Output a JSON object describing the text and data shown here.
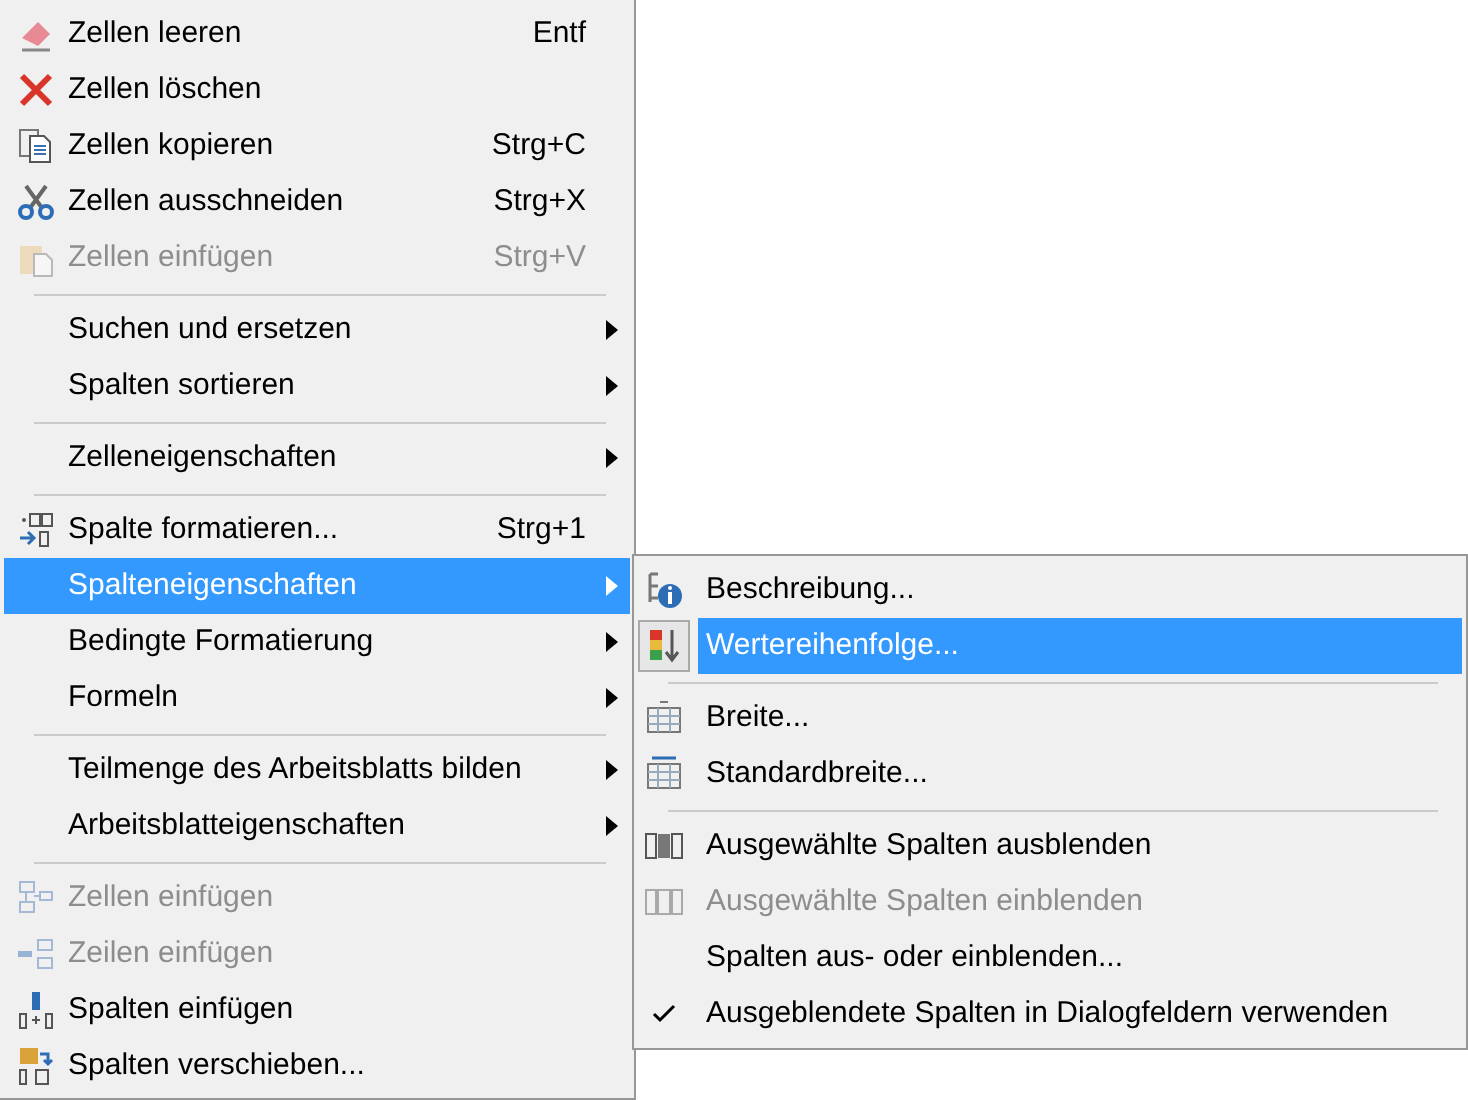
{
  "menu": {
    "items": [
      {
        "kind": "item",
        "label": "Zellen leeren",
        "shortcut": "Entf",
        "submenu": false,
        "disabled": false,
        "selected": false
      },
      {
        "kind": "item",
        "label": "Zellen löschen",
        "submenu": false,
        "disabled": false,
        "selected": false
      },
      {
        "kind": "item",
        "label": "Zellen kopieren",
        "shortcut": "Strg+C",
        "submenu": false,
        "disabled": false,
        "selected": false
      },
      {
        "kind": "item",
        "label": "Zellen ausschneiden",
        "shortcut": "Strg+X",
        "submenu": false,
        "disabled": false,
        "selected": false
      },
      {
        "kind": "item",
        "label": "Zellen einfügen",
        "shortcut": "Strg+V",
        "submenu": false,
        "disabled": true,
        "selected": false
      },
      {
        "kind": "separator"
      },
      {
        "kind": "item",
        "label": "Suchen und ersetzen",
        "submenu": true,
        "disabled": false,
        "selected": false
      },
      {
        "kind": "item",
        "label": "Spalten sortieren",
        "submenu": true,
        "disabled": false,
        "selected": false
      },
      {
        "kind": "separator"
      },
      {
        "kind": "item",
        "label": "Zelleneigenschaften",
        "submenu": true,
        "disabled": false,
        "selected": false
      },
      {
        "kind": "separator"
      },
      {
        "kind": "item",
        "label": "Spalte formatieren...",
        "shortcut": "Strg+1",
        "submenu": false,
        "disabled": false,
        "selected": false
      },
      {
        "kind": "item",
        "label": "Spalteneigenschaften",
        "submenu": true,
        "disabled": false,
        "selected": true
      },
      {
        "kind": "item",
        "label": "Bedingte Formatierung",
        "submenu": true,
        "disabled": false,
        "selected": false
      },
      {
        "kind": "item",
        "label": "Formeln",
        "submenu": true,
        "disabled": false,
        "selected": false
      },
      {
        "kind": "separator"
      },
      {
        "kind": "item",
        "label": "Teilmenge des Arbeitsblatts bilden",
        "submenu": true,
        "disabled": false,
        "selected": false
      },
      {
        "kind": "item",
        "label": "Arbeitsblatteigenschaften",
        "submenu": true,
        "disabled": false,
        "selected": false
      },
      {
        "kind": "separator"
      },
      {
        "kind": "item",
        "label": "Zellen einfügen",
        "submenu": false,
        "disabled": true,
        "selected": false
      },
      {
        "kind": "item",
        "label": "Zeilen einfügen",
        "submenu": false,
        "disabled": true,
        "selected": false
      },
      {
        "kind": "item",
        "label": "Spalten einfügen",
        "submenu": false,
        "disabled": false,
        "selected": false
      },
      {
        "kind": "item",
        "label": "Spalten verschieben...",
        "submenu": false,
        "disabled": false,
        "selected": false
      }
    ]
  },
  "submenu": {
    "items": [
      {
        "kind": "item",
        "label": "Beschreibung...",
        "disabled": false,
        "selected": false,
        "checked": false
      },
      {
        "kind": "item",
        "label": "Wertereihenfolge...",
        "disabled": false,
        "selected": true,
        "checked": false
      },
      {
        "kind": "separator"
      },
      {
        "kind": "item",
        "label": "Breite...",
        "disabled": false,
        "selected": false,
        "checked": false
      },
      {
        "kind": "item",
        "label": "Standardbreite...",
        "disabled": false,
        "selected": false,
        "checked": false
      },
      {
        "kind": "separator"
      },
      {
        "kind": "item",
        "label": "Ausgewählte Spalten ausblenden",
        "disabled": false,
        "selected": false,
        "checked": false
      },
      {
        "kind": "item",
        "label": "Ausgewählte Spalten einblenden",
        "disabled": true,
        "selected": false,
        "checked": false
      },
      {
        "kind": "item",
        "label": "Spalten aus- oder einblenden...",
        "disabled": false,
        "selected": false,
        "checked": false
      },
      {
        "kind": "item",
        "label": "Ausgeblendete Spalten in Dialogfeldern verwenden",
        "disabled": false,
        "selected": false,
        "checked": true
      }
    ]
  }
}
